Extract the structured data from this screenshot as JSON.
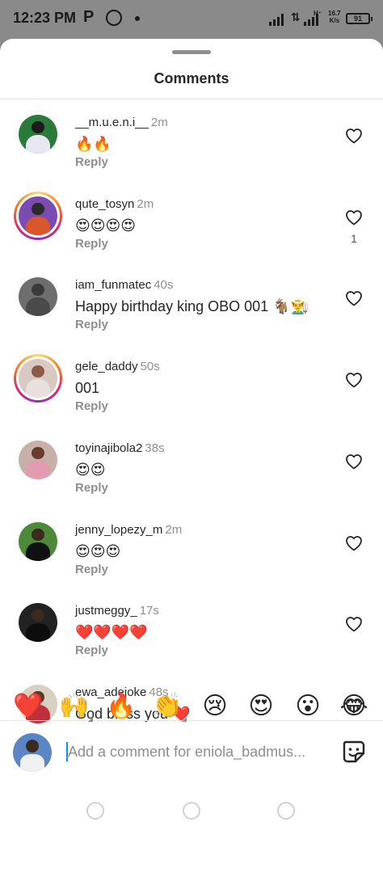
{
  "status_bar": {
    "time": "12:23 PM",
    "p_label": "P",
    "net_speed": "16.7",
    "net_unit": "K/s",
    "battery": "91",
    "ht": "H⁺"
  },
  "header": {
    "title": "Comments"
  },
  "comments": [
    {
      "username": "__m.u.e.n.i__",
      "time": "2m",
      "text": "🔥🔥",
      "reply": "Reply",
      "likes": "",
      "avatar_colors": [
        "#2a7a3b",
        "#1b1b1b",
        "#e8e8f2"
      ],
      "ring": false
    },
    {
      "username": "qute_tosyn",
      "time": "2m",
      "text": "😍😍😍😍",
      "reply": "Reply",
      "likes": "1",
      "avatar_colors": [
        "#7a4bb0",
        "#2b2b2b",
        "#d9582b"
      ],
      "ring": true
    },
    {
      "username": "iam_funmatec",
      "time": "40s",
      "text": "Happy birthday king OBO 001 🐐👨‍🌾",
      "reply": "Reply",
      "likes": "",
      "avatar_colors": [
        "#6e6e6e",
        "#3a3a3a",
        "#4a4a4a"
      ],
      "ring": false
    },
    {
      "username": "gele_daddy",
      "time": "50s",
      "text": "001",
      "reply": "Reply",
      "likes": "",
      "avatar_colors": [
        "#d9c9c2",
        "#8a5a4a",
        "#e8e0dc"
      ],
      "ring": true
    },
    {
      "username": "toyinajibola2",
      "time": "38s",
      "text": "😍😍",
      "reply": "Reply",
      "likes": "",
      "avatar_colors": [
        "#c7b0a8",
        "#6a3b2a",
        "#e39bb0"
      ],
      "ring": false
    },
    {
      "username": "jenny_lopezy_m",
      "time": "2m",
      "text": "😍😍😍",
      "reply": "Reply",
      "likes": "",
      "avatar_colors": [
        "#4c8a3a",
        "#3b2a20",
        "#111111"
      ],
      "ring": false
    },
    {
      "username": "justmeggy_",
      "time": "17s",
      "text": "❤️❤️❤️❤️",
      "reply": "Reply",
      "likes": "",
      "avatar_colors": [
        "#222222",
        "#3b2a20",
        "#0d0d0d"
      ],
      "ring": false
    },
    {
      "username": "ewa_adejoke",
      "time": "48s",
      "text": "God bless you ❤️",
      "reply": "",
      "likes": "",
      "avatar_colors": [
        "#d8d0c0",
        "#5a3a2a",
        "#c0303a"
      ],
      "ring": false
    }
  ],
  "emoji_bar": [
    "❤️",
    "🙌",
    "🔥",
    "👏",
    "😢",
    "😍",
    "😮",
    "😂"
  ],
  "composer": {
    "placeholder": "Add a comment for eniola_badmus..."
  },
  "colors": {
    "like_icon": "#262626",
    "muted_text": "#8e8e8e",
    "accent_caret": "#0095f6",
    "story_ring": "#d62976"
  }
}
